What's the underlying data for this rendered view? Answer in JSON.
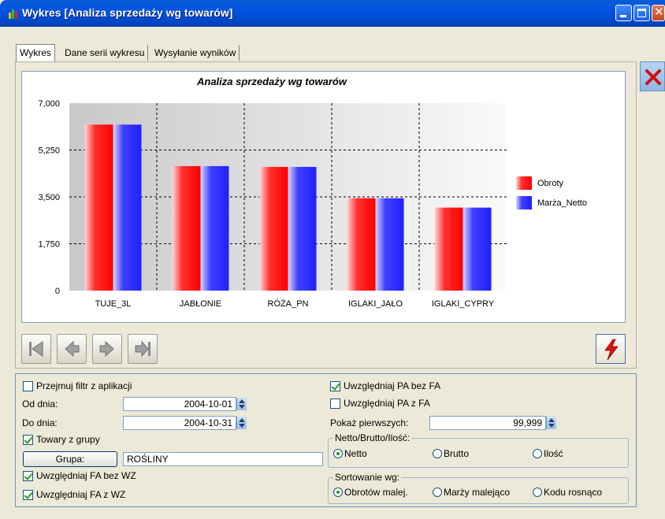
{
  "window": {
    "title": "Wykres [Analiza sprzedaży wg towarów]"
  },
  "tabs": [
    {
      "label": "Wykres",
      "active": true
    },
    {
      "label": "Dane serii wykresu",
      "active": false
    },
    {
      "label": "Wysyłanie wyników",
      "active": false
    }
  ],
  "chart_data": {
    "type": "bar",
    "title": "Analiza sprzedaży wg towarów",
    "categories": [
      "TUJE_3L",
      "JABŁONIE",
      "RÓŻA_PN",
      "IGLAKI_JAŁO",
      "IGLAKI_CYPRY"
    ],
    "series": [
      {
        "name": "Obroty",
        "values": [
          6200,
          4650,
          4620,
          3450,
          3100
        ],
        "color": "#ff2020"
      },
      {
        "name": "Marża_Netto",
        "values": [
          6200,
          4650,
          4620,
          3450,
          3100
        ],
        "color": "#3030ff"
      }
    ],
    "yticks": [
      "7,000",
      "5,250",
      "3,500",
      "1,750",
      "0"
    ],
    "ylim": [
      0,
      7000
    ],
    "legend_position": "right",
    "grid": true
  },
  "filters": {
    "przejmuj_filtr": {
      "label": "Przejmuj filtr z aplikacji",
      "checked": false
    },
    "od_dnia": {
      "label": "Od dnia:",
      "value": "2004-10-01"
    },
    "do_dnia": {
      "label": "Do dnia:",
      "value": "2004-10-31"
    },
    "towary_z_grupy": {
      "label": "Towary z grupy",
      "checked": true
    },
    "grupa_button": "Grupa:",
    "grupa_value": "ROŚLINY",
    "fa_bez_wz": {
      "label": "Uwzględniaj FA bez WZ",
      "checked": true
    },
    "fa_z_wz": {
      "label": "Uwzględniaj FA z WZ",
      "checked": true
    },
    "pa_bez_fa": {
      "label": "Uwzględniaj PA bez FA",
      "checked": true
    },
    "pa_z_fa": {
      "label": "Uwzględniaj PA z FA",
      "checked": false
    },
    "pokaz_pierwszych": {
      "label": "Pokaż pierwszych:",
      "value": "99,999"
    },
    "netto_group": {
      "title": "Netto/Brutto/Ilość:",
      "options": [
        "Netto",
        "Brutto",
        "Ilość"
      ],
      "selected": "Netto"
    },
    "sort_group": {
      "title": "Sortowanie wg:",
      "options": [
        "Obrotów malej.",
        "Marży malejąco",
        "Kodu rosnąco"
      ],
      "selected": "Obrotów malej."
    }
  },
  "icons": {
    "app": "bar-chart-icon",
    "nav": [
      "first-record-icon",
      "prev-record-icon",
      "next-record-icon",
      "last-record-icon"
    ],
    "run": "lightning-icon",
    "cancel": "red-x-icon"
  }
}
